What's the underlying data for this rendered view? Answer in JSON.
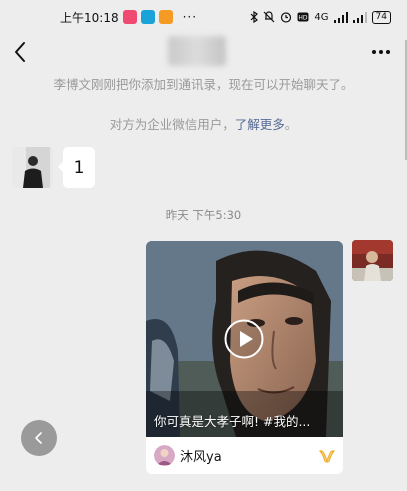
{
  "status_bar": {
    "time": "上午10:18",
    "more_dots": "···",
    "network_label": "4G",
    "battery": "74"
  },
  "nav": {
    "back_icon": "chevron-left-icon",
    "more_icon": "more-dots-icon",
    "more_label": "···"
  },
  "system_messages": {
    "added_notice": "李博文刚刚把你添加到通讯录，现在可以开始聊天了。",
    "enterprise_notice_prefix": "对方为企业微信用户，",
    "enterprise_notice_link": "了解更多",
    "enterprise_notice_suffix": "。"
  },
  "messages": [
    {
      "side": "left",
      "text": "1"
    }
  ],
  "timestamp": "昨天 下午5:30",
  "video_card": {
    "caption": "你可真是大孝子啊! #我的...",
    "author": "沐风ya",
    "play_icon": "play-icon",
    "badge_icon": "channels-icon",
    "badge_color": "#f2b233"
  },
  "floating_button": {
    "icon": "chevron-left-icon"
  },
  "colors": {
    "background": "#ededed",
    "link": "#576b95",
    "bubble": "#ffffff"
  }
}
